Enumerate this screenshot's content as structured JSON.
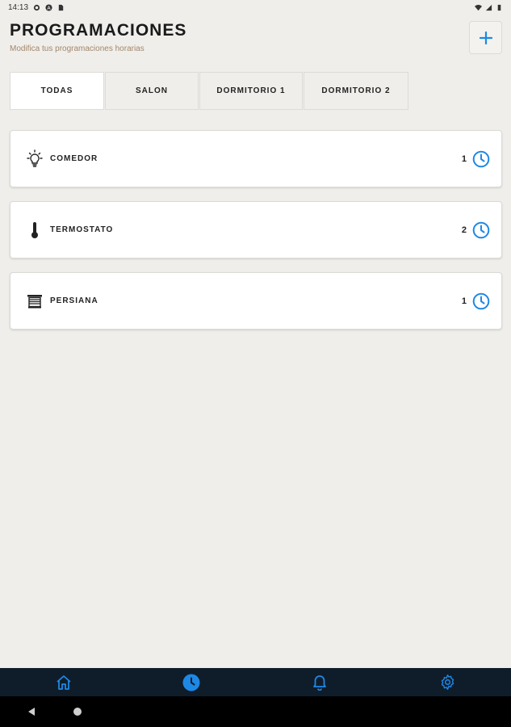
{
  "status_bar": {
    "time": "14:13"
  },
  "header": {
    "title": "PROGRAMACIONES",
    "subtitle": "Modifica tus programaciones horarias",
    "add_label": "+"
  },
  "tabs": [
    {
      "label": "TODAS",
      "active": true
    },
    {
      "label": "SALON",
      "active": false
    },
    {
      "label": "DORMITORIO 1",
      "active": false
    },
    {
      "label": "DORMITORIO 2",
      "active": false
    }
  ],
  "schedules": [
    {
      "label": "COMEDOR",
      "count": "1",
      "icon": "light-bulb-icon"
    },
    {
      "label": "TERMOSTATO",
      "count": "2",
      "icon": "thermometer-icon"
    },
    {
      "label": "PERSIANA",
      "count": "1",
      "icon": "blind-icon"
    }
  ],
  "bottom_nav": [
    {
      "icon": "home-icon",
      "active": false
    },
    {
      "icon": "clock-icon",
      "active": true
    },
    {
      "icon": "bell-icon",
      "active": false
    },
    {
      "icon": "gear-icon",
      "active": false
    }
  ],
  "colors": {
    "accent": "#1e88e5",
    "background": "#efeeeb",
    "subtitle": "#a3876a",
    "nav_bg": "#0f1d2a"
  }
}
